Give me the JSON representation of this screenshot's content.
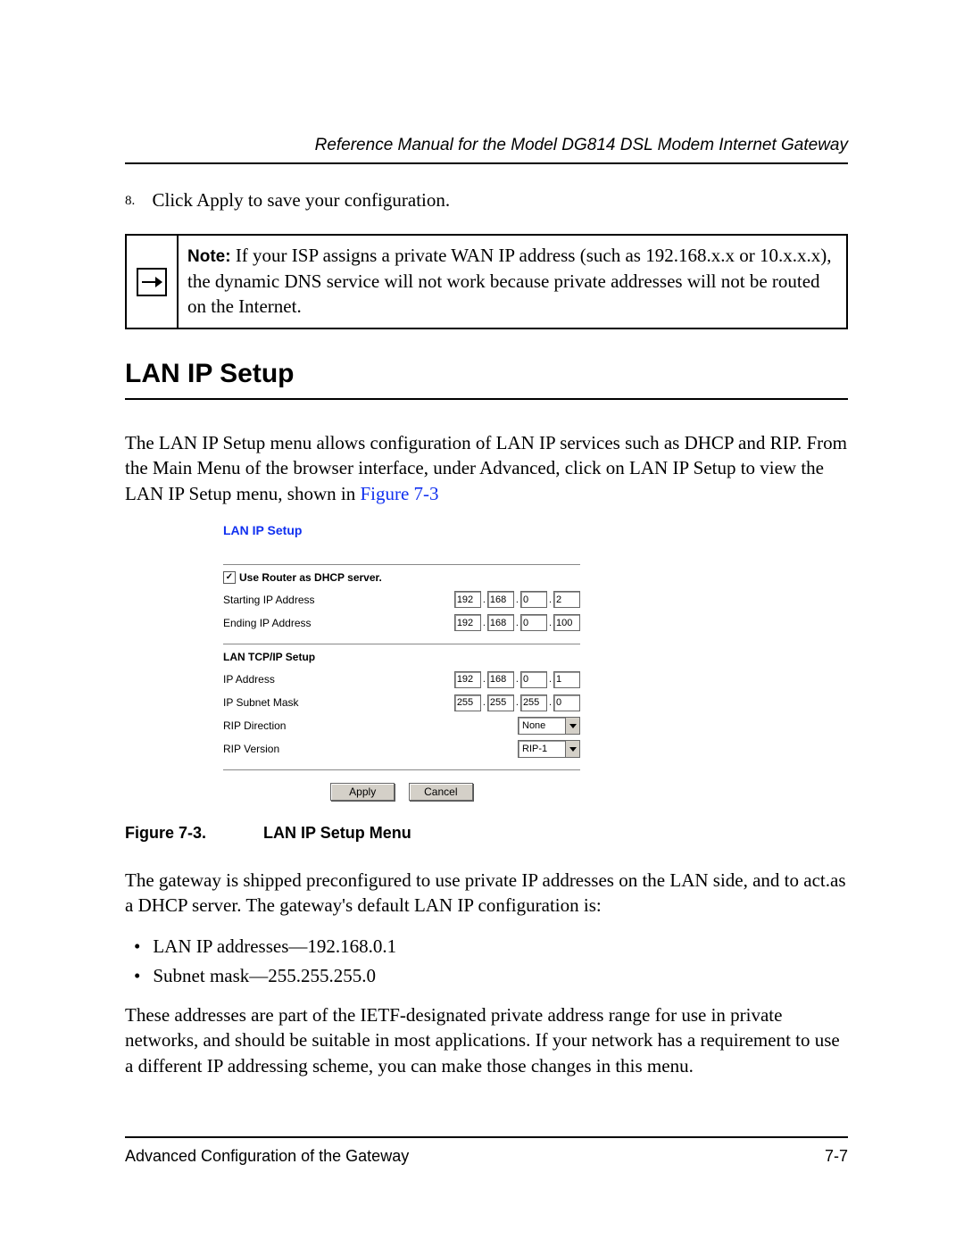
{
  "header": {
    "running_title": "Reference Manual for the Model DG814 DSL Modem Internet Gateway"
  },
  "step": {
    "number": "8.",
    "text": "Click Apply to save your configuration."
  },
  "note": {
    "label": "Note:",
    "text": "If your ISP assigns a private WAN IP address (such as 192.168.x.x or 10.x.x.x), the dynamic DNS service will not work because private addresses will not be routed on the Internet."
  },
  "section_heading": "LAN IP Setup",
  "intro_para_a": "The LAN IP Setup menu allows configuration of LAN IP services such as DHCP and RIP. From the Main Menu of the browser interface, under Advanced, click on LAN IP Setup to view the LAN IP Setup menu, shown in ",
  "intro_link": "Figure 7-3",
  "screenshot": {
    "title": "LAN IP Setup",
    "dhcp_checkbox_label": "Use Router as DHCP server.",
    "dhcp_checked": "✓",
    "row1_label": "Starting IP Address",
    "row1_ip": [
      "192",
      "168",
      "0",
      "2"
    ],
    "row2_label": "Ending IP Address",
    "row2_ip": [
      "192",
      "168",
      "0",
      "100"
    ],
    "tcp_heading": "LAN TCP/IP Setup",
    "row3_label": "IP Address",
    "row3_ip": [
      "192",
      "168",
      "0",
      "1"
    ],
    "row4_label": "IP Subnet Mask",
    "row4_ip": [
      "255",
      "255",
      "255",
      "0"
    ],
    "row5_label": "RIP Direction",
    "row5_value": "None",
    "row6_label": "RIP Version",
    "row6_value": "RIP-1",
    "btn_apply": "Apply",
    "btn_cancel": "Cancel"
  },
  "caption": {
    "label": "Figure 7-3.",
    "text": "LAN IP Setup Menu"
  },
  "para2": "The gateway is shipped preconfigured to use private IP addresses on the LAN side, and to act.as a DHCP server. The gateway's default LAN IP configuration is:",
  "bullets": [
    "LAN IP addresses—192.168.0.1",
    "Subnet mask—255.255.255.0"
  ],
  "para3": "These addresses are part of the IETF-designated private address range for use in private networks, and should be suitable in most applications. If your network has a requirement to use a different IP addressing scheme, you can make those changes in this menu.",
  "footer": {
    "left": "Advanced Configuration of the Gateway",
    "right": "7-7"
  }
}
